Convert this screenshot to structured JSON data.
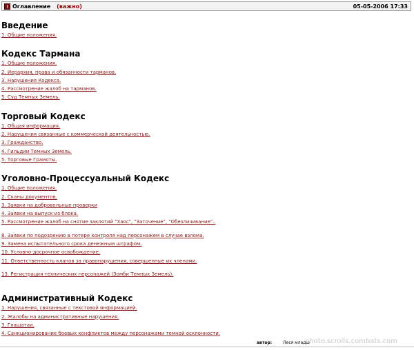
{
  "header": {
    "title": "Оглавление",
    "note": "(важно)",
    "date": "05-05-2006 17:33"
  },
  "sections": [
    {
      "title": "Введение",
      "items": [
        "1. Общие положения."
      ]
    },
    {
      "title": "Кодекс Тармана",
      "items": [
        "1. Общие положения.",
        "2. Иерархия, права и обязанности тарманов.",
        "3. Нарушения Кодекса.",
        "4. Рассмотрение жалоб на тарманов.",
        "5. Суд Темных Земель."
      ]
    },
    {
      "title": "Торговый Кодекс",
      "items": [
        "1. Общая информация.",
        "2. Нарушения связанные с коммерческой деятельностью.",
        "3. Гражданство.",
        "4. Гильдии Темных Земель.",
        "5. Торговые Грамоты."
      ]
    },
    {
      "title": "Уголовно-Процессуальный Кодекс",
      "items": [
        "1. Общие положения.",
        "2. Сканы документов.",
        "3. Заявки на добровольные проверки",
        "4. Заявки на выпуск из блока.",
        "5. Рассмотрение жалоб на снятие заклятий \"Хаос\", \"Заточение\", \"Обезличивание\"..",
        "8. Заявки по подозрению в потере контроля над персонажем в случае взлома.",
        "9. Замена испытательного срока денежным штрафом.",
        "10. Условно-досрочное освобождение.",
        "11. Ответственность кланов за правонарушения, совершенные их членами.",
        "13. Регистрация технических персонажей (Зомби Темных Земель)."
      ]
    },
    {
      "title": "Административный Кодекс",
      "items": [
        "1. Нарушения, связанные с текстовой информацией.",
        "2. Жалобы на административные нарушения.",
        "3. Глашатаи.",
        "4. Санкционирование боевых конфликтов между персонажами темной осклонности."
      ]
    }
  ],
  "footer": {
    "label": "автор:",
    "author": "Леся младш"
  },
  "watermark": "photo.scrolls.combats.com"
}
